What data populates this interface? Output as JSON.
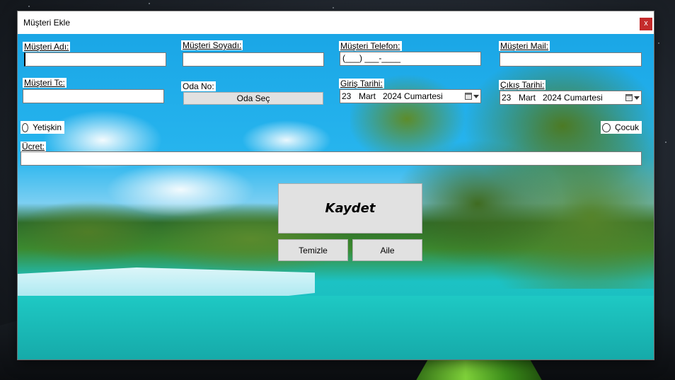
{
  "window": {
    "title": "Müşteri Ekle",
    "close_label": "x"
  },
  "labels": {
    "ad": "Müşteri Adı:",
    "soyad": "Müşteri Soyadı:",
    "telefon": "Müşteri Telefon:",
    "mail": "Müşteri Mail:",
    "tc": "Müşteri Tc:",
    "oda_no": "Oda No:",
    "giris": "Giriş Tarihi:",
    "cikis": "Çıkış Tarihi:",
    "ucret": "Ücret:"
  },
  "fields": {
    "ad": "",
    "soyad": "",
    "telefon_mask": "(___) ___-____",
    "mail": "",
    "tc": "",
    "ucret": ""
  },
  "giris_tarihi": {
    "day": "23",
    "month": "Mart",
    "rest": "2024 Cumartesi"
  },
  "cikis_tarihi": {
    "day": "23",
    "month": "Mart",
    "rest": "2024 Cumartesi"
  },
  "buttons": {
    "oda_sec": "Oda Seç",
    "kaydet": "Kaydet",
    "temizle": "Temizle",
    "aile": "Aile"
  },
  "radios": {
    "yetiskin": "Yetişkin",
    "cocuk": "Çocuk"
  },
  "icons": {
    "close": "close-icon",
    "calendar": "calendar-icon",
    "dropdown": "chevron-down-icon"
  },
  "colors": {
    "close_bg": "#c42b2b",
    "button_bg": "#e1e1e1"
  }
}
